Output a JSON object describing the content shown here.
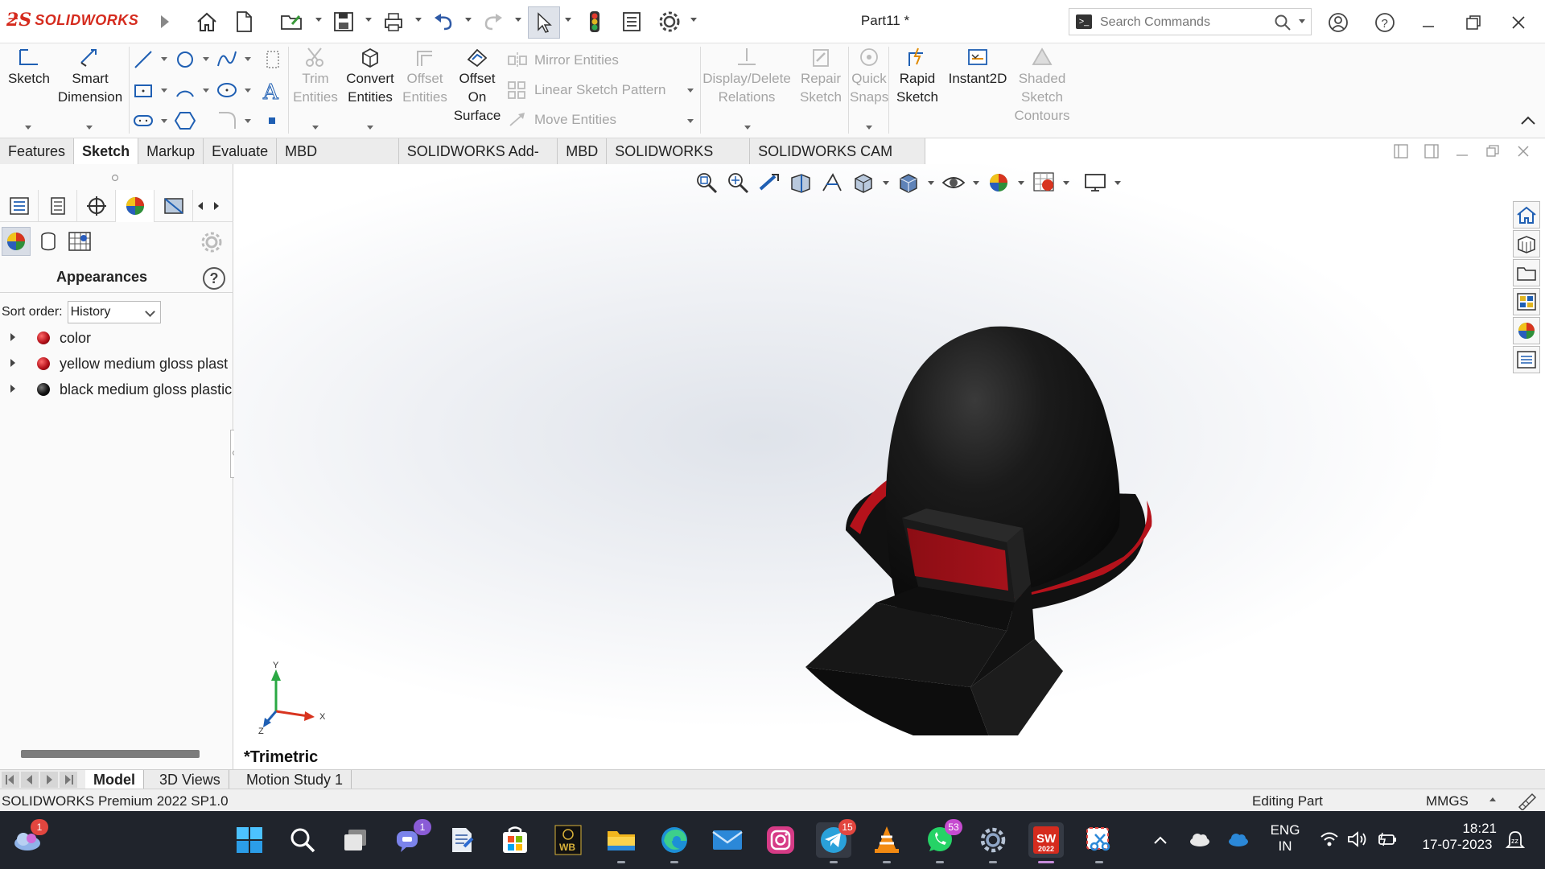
{
  "app": {
    "brand": "SOLIDWORKS",
    "document_title": "Part11 *",
    "search_placeholder": "Search Commands"
  },
  "command_manager": {
    "sketch": "Sketch",
    "smart_dimension_1": "Smart",
    "smart_dimension_2": "Dimension",
    "trim_1": "Trim",
    "trim_2": "Entities",
    "convert_1": "Convert",
    "convert_2": "Entities",
    "offset_1": "Offset",
    "offset_2": "Entities",
    "offset_surface_1": "Offset",
    "offset_surface_2": "On",
    "offset_surface_3": "Surface",
    "mirror": "Mirror Entities",
    "linear_pattern": "Linear Sketch Pattern",
    "move": "Move Entities",
    "display_delete_1": "Display/Delete",
    "display_delete_2": "Relations",
    "repair_1": "Repair",
    "repair_2": "Sketch",
    "quick_snaps_1": "Quick",
    "quick_snaps_2": "Snaps",
    "rapid_1": "Rapid",
    "rapid_2": "Sketch",
    "instant2d": "Instant2D",
    "shaded_1": "Shaded",
    "shaded_2": "Sketch",
    "shaded_3": "Contours"
  },
  "tabs": [
    "Features",
    "Sketch",
    "Markup",
    "Evaluate",
    "MBD Dimensions",
    "SOLIDWORKS Add-Ins",
    "MBD",
    "SOLIDWORKS CAM",
    "SOLIDWORKS CAM TBM"
  ],
  "active_tab": "Sketch",
  "appearances_panel": {
    "title": "Appearances",
    "sort_label": "Sort order:",
    "sort_value": "History",
    "items": [
      {
        "label": "color",
        "color": "#c0161b"
      },
      {
        "label": "yellow medium gloss plast",
        "color": "#c0161b"
      },
      {
        "label": "black medium gloss plastic",
        "color": "#1a1a1a"
      }
    ]
  },
  "viewport": {
    "view_name": "*Trimetric",
    "triad": {
      "x": "X",
      "y": "Y",
      "z": "Z"
    }
  },
  "bottom_tabs": [
    "Model",
    "3D Views",
    "Motion Study 1"
  ],
  "active_bottom_tab": "Model",
  "status_bar": {
    "product": "SOLIDWORKS Premium 2022 SP1.0",
    "mode": "Editing Part",
    "units": "MMGS"
  },
  "taskbar": {
    "weather_badge": "1",
    "teams_badge": "1",
    "telegram_badge": "15",
    "whatsapp_badge": "53",
    "sw_label": "2022",
    "lang_1": "ENG",
    "lang_2": "IN",
    "time": "18:21",
    "date": "17-07-2023"
  },
  "colors": {
    "accent_red": "#d52b1e",
    "helmet_black": "#151515",
    "helmet_red": "#b5121b"
  }
}
